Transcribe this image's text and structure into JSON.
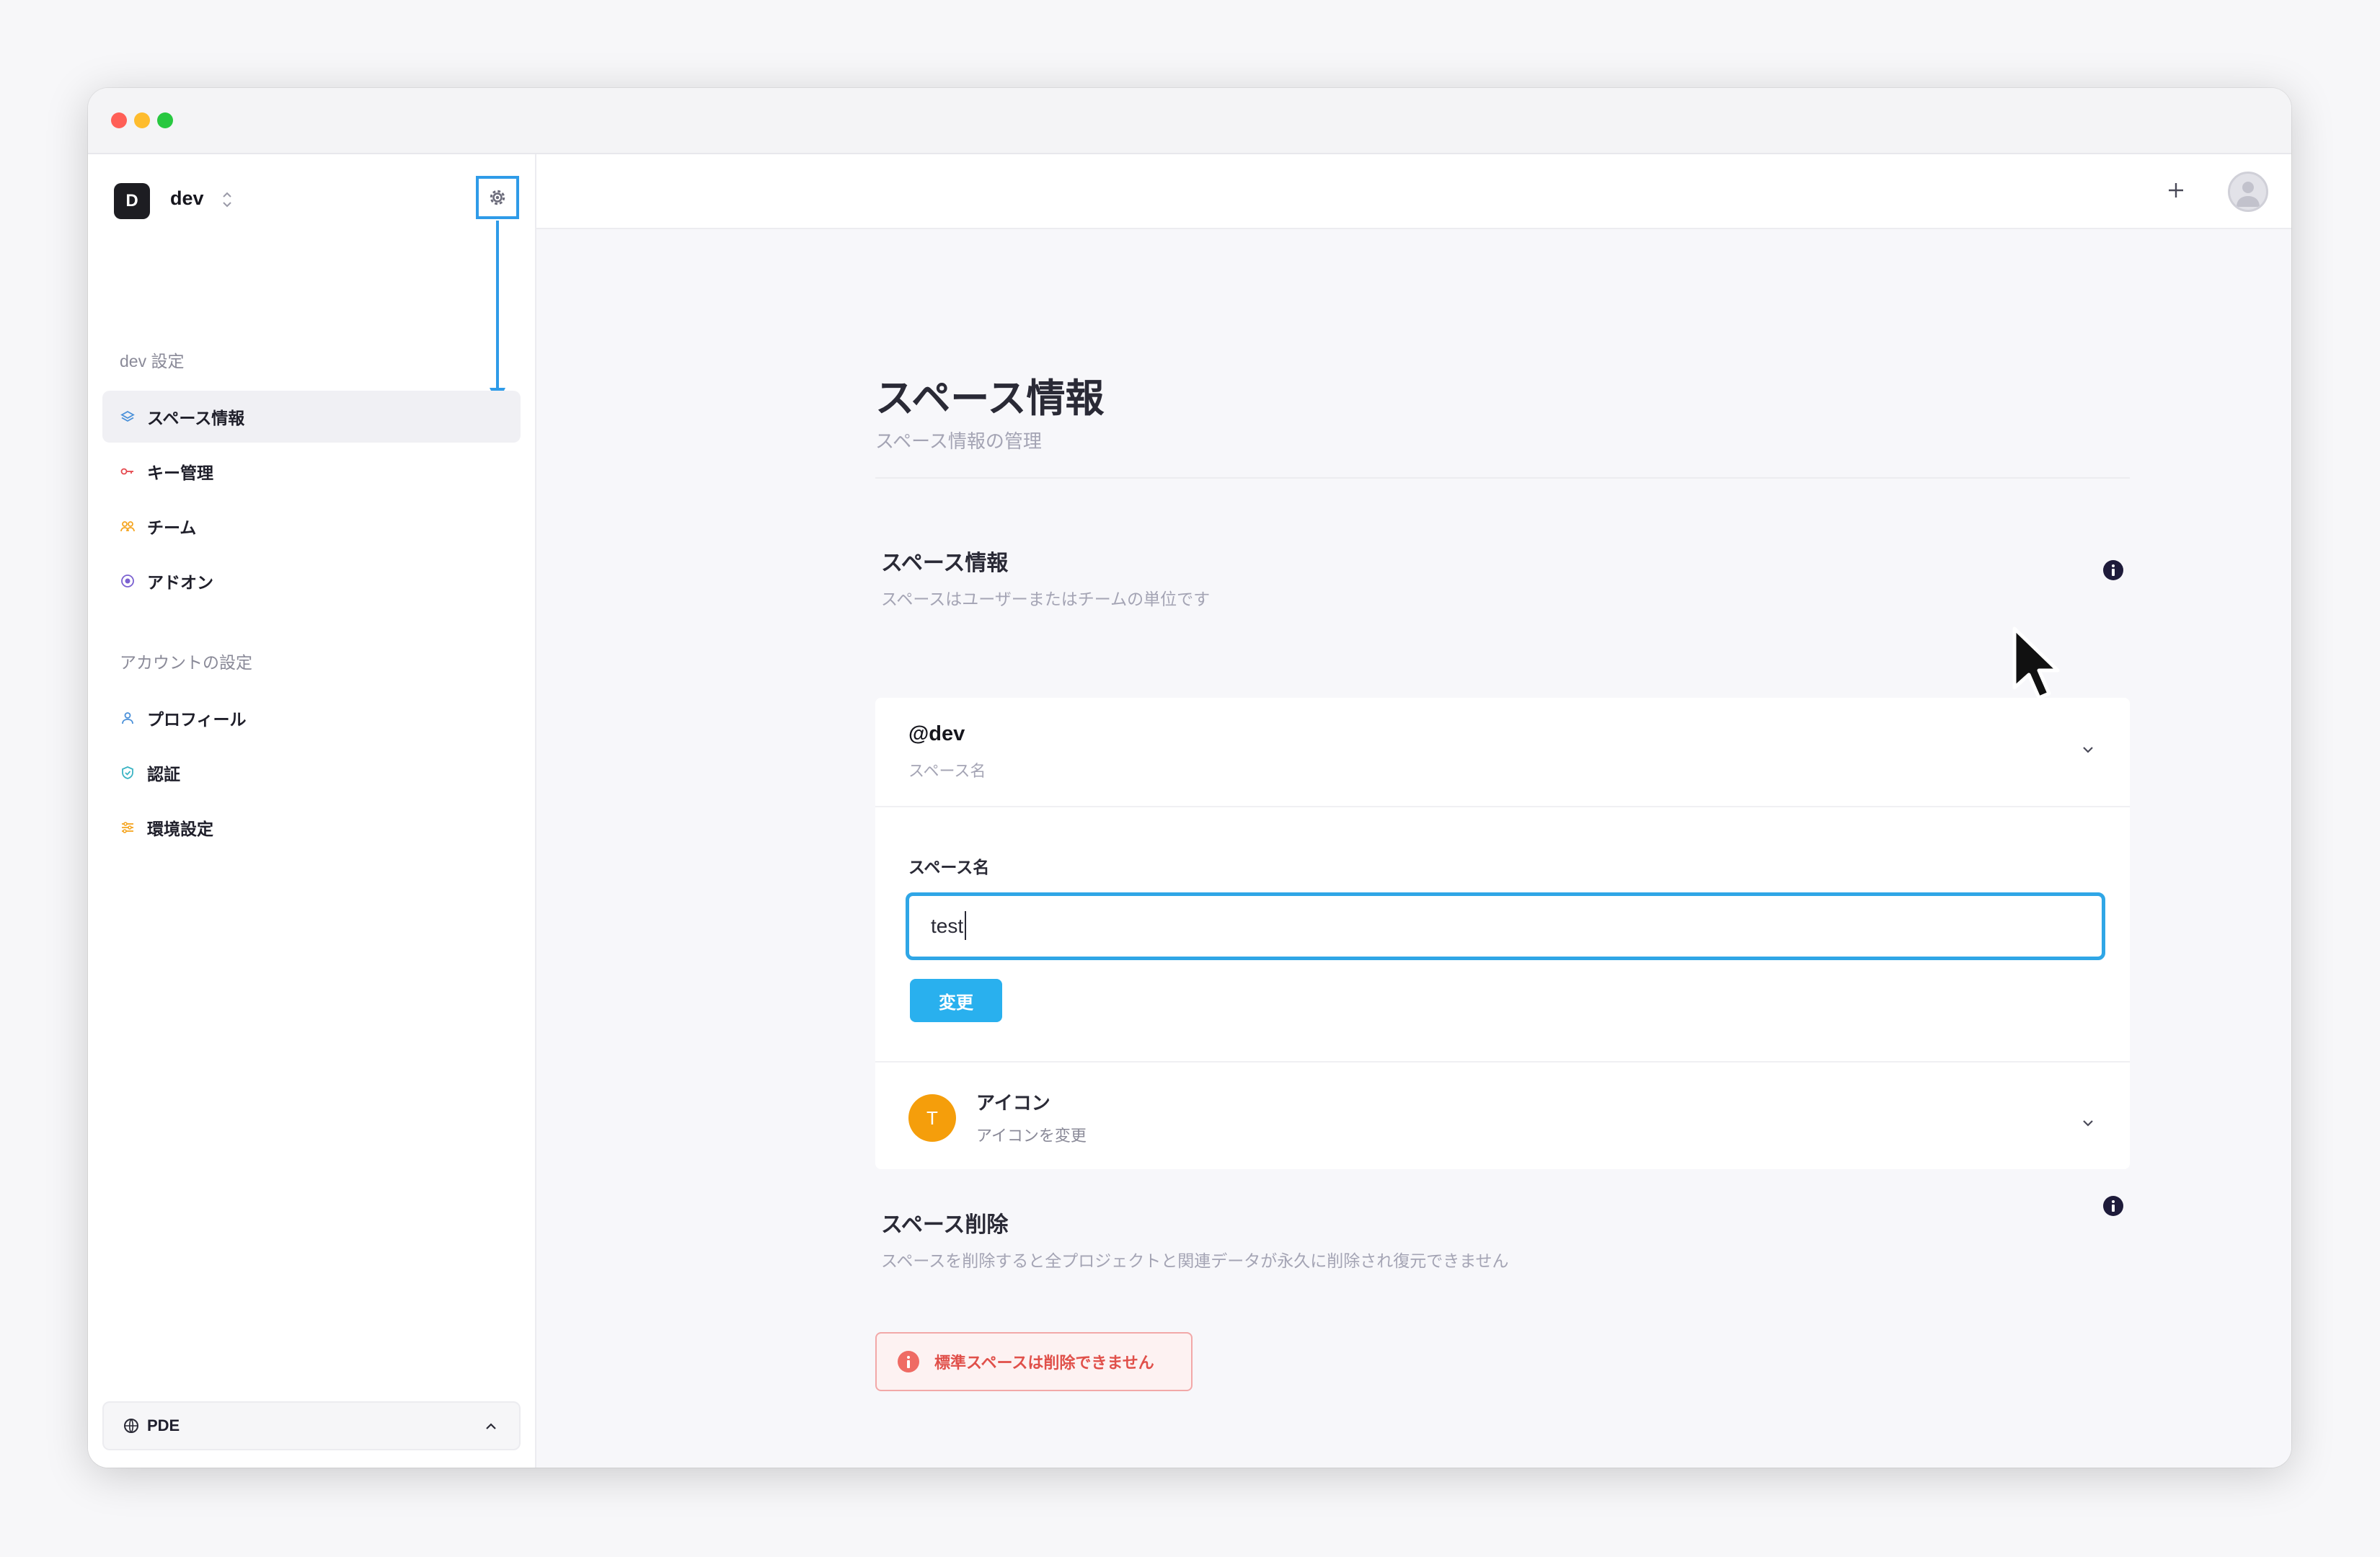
{
  "sidebar": {
    "space": {
      "badge": "D",
      "name": "dev"
    },
    "section_space_label": "dev 設定",
    "space_items": [
      {
        "label": "スペース情報",
        "icon": "layers-icon",
        "icon_color": "#4a90d9"
      },
      {
        "label": "キー管理",
        "icon": "key-icon",
        "icon_color": "#e5484d"
      },
      {
        "label": "チーム",
        "icon": "team-icon",
        "icon_color": "#f5a623"
      },
      {
        "label": "アドオン",
        "icon": "addon-icon",
        "icon_color": "#7b61d1"
      }
    ],
    "section_account_label": "アカウントの設定",
    "account_items": [
      {
        "label": "プロフィール",
        "icon": "user-icon",
        "icon_color": "#4a90d9"
      },
      {
        "label": "認証",
        "icon": "shield-icon",
        "icon_color": "#3cb4c4"
      },
      {
        "label": "環境設定",
        "icon": "sliders-icon",
        "icon_color": "#f5a623"
      }
    ],
    "footer_label": "PDE"
  },
  "main": {
    "title": "スペース情報",
    "subtitle": "スペース情報の管理",
    "info_section": {
      "title": "スペース情報",
      "description": "スペースはユーザーまたはチームの単位です",
      "handle": "@dev",
      "handle_sub": "スペース名",
      "field_label": "スペース名",
      "field_value": "test",
      "save_button": "変更",
      "icon_avatar_letter": "T",
      "icon_title": "アイコン",
      "icon_subtitle": "アイコンを変更"
    },
    "delete_section": {
      "title": "スペース削除",
      "description": "スペースを削除すると全プロジェクトと関連データが永久に削除され復元できません",
      "alert_text": "標準スペースは削除できません"
    }
  },
  "colors": {
    "accent": "#29b0ee",
    "highlight": "#2f9be8",
    "danger": "#e0504a",
    "icon_avatar": "#f59e0b"
  }
}
